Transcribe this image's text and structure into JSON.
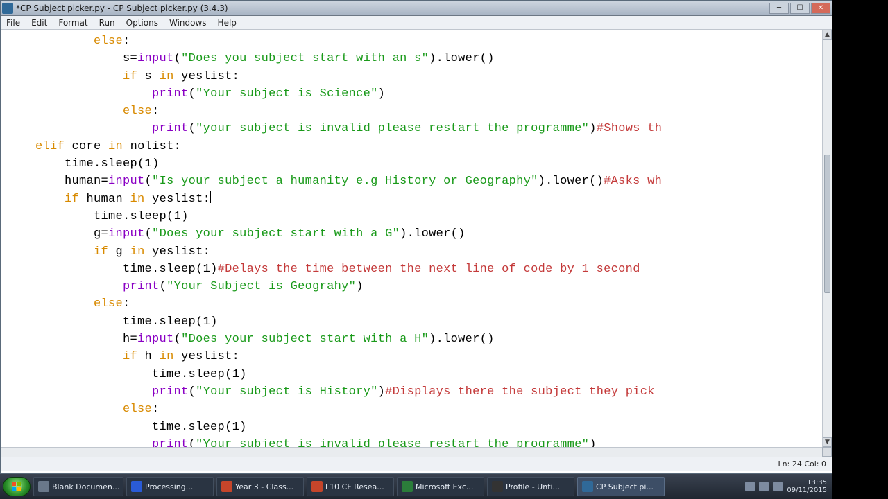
{
  "title": "*CP Subject picker.py - CP Subject picker.py (3.4.3)",
  "menu": [
    "File",
    "Edit",
    "Format",
    "Run",
    "Options",
    "Windows",
    "Help"
  ],
  "status": "Ln: 24 Col: 0",
  "code": {
    "l01_kw": "else",
    "l01_p": ":",
    "l02_a": "s=",
    "l02_fn": "input",
    "l02_p1": "(",
    "l02_s": "\"Does you subject start with an s\"",
    "l02_p2": ").lower()",
    "l03_kw": "if",
    "l03_mid": " s ",
    "l03_kw2": "in",
    "l03_end": " yeslist:",
    "l04_fn": "print",
    "l04_p1": "(",
    "l04_s": "\"Your subject is Science\"",
    "l04_p2": ")",
    "l05_kw": "else",
    "l05_p": ":",
    "l06_fn": "print",
    "l06_p1": "(",
    "l06_s": "\"your subject is invalid please restart the programme\"",
    "l06_p2": ")",
    "l06_c": "#Shows th",
    "l07_kw": "elif",
    "l07_mid": " core ",
    "l07_kw2": "in",
    "l07_end": " nolist:",
    "l08_a": "time.sleep(",
    "l08_n": "1",
    "l08_b": ")",
    "l09_a": "human=",
    "l09_fn": "input",
    "l09_p1": "(",
    "l09_s": "\"Is your subject a humanity e.g History or Geography\"",
    "l09_p2": ").lower()",
    "l09_c": "#Asks wh",
    "l10_kw": "if",
    "l10_mid": " human ",
    "l10_kw2": "in",
    "l10_end": " yeslist:",
    "l11_a": "time.sleep(",
    "l11_n": "1",
    "l11_b": ")",
    "l12_a": "g=",
    "l12_fn": "input",
    "l12_p1": "(",
    "l12_s": "\"Does your subject start with a G\"",
    "l12_p2": ").lower()",
    "l13_kw": "if",
    "l13_mid": " g ",
    "l13_kw2": "in",
    "l13_end": " yeslist:",
    "l14_a": "time.sleep(",
    "l14_n": "1",
    "l14_b": ")",
    "l14_c": "#Delays the time between the next line of code by 1 second",
    "l15_fn": "print",
    "l15_p1": "(",
    "l15_s": "\"Your Subject is Geograhy\"",
    "l15_p2": ")",
    "l16_kw": "else",
    "l16_p": ":",
    "l17_a": "time.sleep(",
    "l17_n": "1",
    "l17_b": ")",
    "l18_a": "h=",
    "l18_fn": "input",
    "l18_p1": "(",
    "l18_s": "\"Does your subject start with a H\"",
    "l18_p2": ").lower()",
    "l19_kw": "if",
    "l19_mid": " h ",
    "l19_kw2": "in",
    "l19_end": " yeslist:",
    "l20_a": "time.sleep(",
    "l20_n": "1",
    "l20_b": ")",
    "l21_fn": "print",
    "l21_p1": "(",
    "l21_s": "\"Your subject is History\"",
    "l21_p2": ")",
    "l21_c": "#Displays there the subject they pick",
    "l22_kw": "else",
    "l22_p": ":",
    "l23_a": "time.sleep(",
    "l23_n": "1",
    "l23_b": ")",
    "l24_fn": "print",
    "l24_p1": "(",
    "l24_s": "\"Your subject is invalid please restart the programme\"",
    "l24_p2": ")"
  },
  "taskbar": {
    "items": [
      {
        "label": "Blank Documen...",
        "icon": "doc"
      },
      {
        "label": "Processing...",
        "icon": "word"
      },
      {
        "label": "Year 3 - Class...",
        "icon": "pp"
      },
      {
        "label": "L10 CF Resea...",
        "icon": "pp"
      },
      {
        "label": "Microsoft Exc...",
        "icon": "xl"
      },
      {
        "label": "Profile - Unti...",
        "icon": "obs"
      },
      {
        "label": "CP Subject pi...",
        "icon": "py",
        "active": true
      }
    ]
  },
  "clock": {
    "time": "13:35",
    "date": "09/11/2015"
  }
}
